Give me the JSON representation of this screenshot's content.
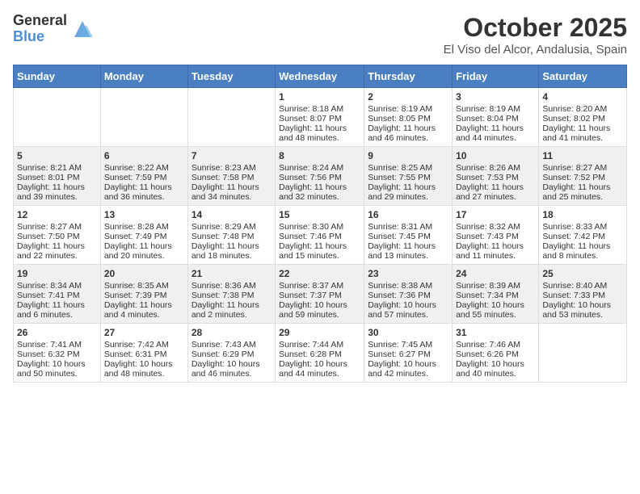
{
  "header": {
    "logo_general": "General",
    "logo_blue": "Blue",
    "month": "October 2025",
    "location": "El Viso del Alcor, Andalusia, Spain"
  },
  "days_of_week": [
    "Sunday",
    "Monday",
    "Tuesday",
    "Wednesday",
    "Thursday",
    "Friday",
    "Saturday"
  ],
  "weeks": [
    [
      {
        "day": "",
        "sunrise": "",
        "sunset": "",
        "daylight": ""
      },
      {
        "day": "",
        "sunrise": "",
        "sunset": "",
        "daylight": ""
      },
      {
        "day": "",
        "sunrise": "",
        "sunset": "",
        "daylight": ""
      },
      {
        "day": "1",
        "sunrise": "Sunrise: 8:18 AM",
        "sunset": "Sunset: 8:07 PM",
        "daylight": "Daylight: 11 hours and 48 minutes."
      },
      {
        "day": "2",
        "sunrise": "Sunrise: 8:19 AM",
        "sunset": "Sunset: 8:05 PM",
        "daylight": "Daylight: 11 hours and 46 minutes."
      },
      {
        "day": "3",
        "sunrise": "Sunrise: 8:19 AM",
        "sunset": "Sunset: 8:04 PM",
        "daylight": "Daylight: 11 hours and 44 minutes."
      },
      {
        "day": "4",
        "sunrise": "Sunrise: 8:20 AM",
        "sunset": "Sunset: 8:02 PM",
        "daylight": "Daylight: 11 hours and 41 minutes."
      }
    ],
    [
      {
        "day": "5",
        "sunrise": "Sunrise: 8:21 AM",
        "sunset": "Sunset: 8:01 PM",
        "daylight": "Daylight: 11 hours and 39 minutes."
      },
      {
        "day": "6",
        "sunrise": "Sunrise: 8:22 AM",
        "sunset": "Sunset: 7:59 PM",
        "daylight": "Daylight: 11 hours and 36 minutes."
      },
      {
        "day": "7",
        "sunrise": "Sunrise: 8:23 AM",
        "sunset": "Sunset: 7:58 PM",
        "daylight": "Daylight: 11 hours and 34 minutes."
      },
      {
        "day": "8",
        "sunrise": "Sunrise: 8:24 AM",
        "sunset": "Sunset: 7:56 PM",
        "daylight": "Daylight: 11 hours and 32 minutes."
      },
      {
        "day": "9",
        "sunrise": "Sunrise: 8:25 AM",
        "sunset": "Sunset: 7:55 PM",
        "daylight": "Daylight: 11 hours and 29 minutes."
      },
      {
        "day": "10",
        "sunrise": "Sunrise: 8:26 AM",
        "sunset": "Sunset: 7:53 PM",
        "daylight": "Daylight: 11 hours and 27 minutes."
      },
      {
        "day": "11",
        "sunrise": "Sunrise: 8:27 AM",
        "sunset": "Sunset: 7:52 PM",
        "daylight": "Daylight: 11 hours and 25 minutes."
      }
    ],
    [
      {
        "day": "12",
        "sunrise": "Sunrise: 8:27 AM",
        "sunset": "Sunset: 7:50 PM",
        "daylight": "Daylight: 11 hours and 22 minutes."
      },
      {
        "day": "13",
        "sunrise": "Sunrise: 8:28 AM",
        "sunset": "Sunset: 7:49 PM",
        "daylight": "Daylight: 11 hours and 20 minutes."
      },
      {
        "day": "14",
        "sunrise": "Sunrise: 8:29 AM",
        "sunset": "Sunset: 7:48 PM",
        "daylight": "Daylight: 11 hours and 18 minutes."
      },
      {
        "day": "15",
        "sunrise": "Sunrise: 8:30 AM",
        "sunset": "Sunset: 7:46 PM",
        "daylight": "Daylight: 11 hours and 15 minutes."
      },
      {
        "day": "16",
        "sunrise": "Sunrise: 8:31 AM",
        "sunset": "Sunset: 7:45 PM",
        "daylight": "Daylight: 11 hours and 13 minutes."
      },
      {
        "day": "17",
        "sunrise": "Sunrise: 8:32 AM",
        "sunset": "Sunset: 7:43 PM",
        "daylight": "Daylight: 11 hours and 11 minutes."
      },
      {
        "day": "18",
        "sunrise": "Sunrise: 8:33 AM",
        "sunset": "Sunset: 7:42 PM",
        "daylight": "Daylight: 11 hours and 8 minutes."
      }
    ],
    [
      {
        "day": "19",
        "sunrise": "Sunrise: 8:34 AM",
        "sunset": "Sunset: 7:41 PM",
        "daylight": "Daylight: 11 hours and 6 minutes."
      },
      {
        "day": "20",
        "sunrise": "Sunrise: 8:35 AM",
        "sunset": "Sunset: 7:39 PM",
        "daylight": "Daylight: 11 hours and 4 minutes."
      },
      {
        "day": "21",
        "sunrise": "Sunrise: 8:36 AM",
        "sunset": "Sunset: 7:38 PM",
        "daylight": "Daylight: 11 hours and 2 minutes."
      },
      {
        "day": "22",
        "sunrise": "Sunrise: 8:37 AM",
        "sunset": "Sunset: 7:37 PM",
        "daylight": "Daylight: 10 hours and 59 minutes."
      },
      {
        "day": "23",
        "sunrise": "Sunrise: 8:38 AM",
        "sunset": "Sunset: 7:36 PM",
        "daylight": "Daylight: 10 hours and 57 minutes."
      },
      {
        "day": "24",
        "sunrise": "Sunrise: 8:39 AM",
        "sunset": "Sunset: 7:34 PM",
        "daylight": "Daylight: 10 hours and 55 minutes."
      },
      {
        "day": "25",
        "sunrise": "Sunrise: 8:40 AM",
        "sunset": "Sunset: 7:33 PM",
        "daylight": "Daylight: 10 hours and 53 minutes."
      }
    ],
    [
      {
        "day": "26",
        "sunrise": "Sunrise: 7:41 AM",
        "sunset": "Sunset: 6:32 PM",
        "daylight": "Daylight: 10 hours and 50 minutes."
      },
      {
        "day": "27",
        "sunrise": "Sunrise: 7:42 AM",
        "sunset": "Sunset: 6:31 PM",
        "daylight": "Daylight: 10 hours and 48 minutes."
      },
      {
        "day": "28",
        "sunrise": "Sunrise: 7:43 AM",
        "sunset": "Sunset: 6:29 PM",
        "daylight": "Daylight: 10 hours and 46 minutes."
      },
      {
        "day": "29",
        "sunrise": "Sunrise: 7:44 AM",
        "sunset": "Sunset: 6:28 PM",
        "daylight": "Daylight: 10 hours and 44 minutes."
      },
      {
        "day": "30",
        "sunrise": "Sunrise: 7:45 AM",
        "sunset": "Sunset: 6:27 PM",
        "daylight": "Daylight: 10 hours and 42 minutes."
      },
      {
        "day": "31",
        "sunrise": "Sunrise: 7:46 AM",
        "sunset": "Sunset: 6:26 PM",
        "daylight": "Daylight: 10 hours and 40 minutes."
      },
      {
        "day": "",
        "sunrise": "",
        "sunset": "",
        "daylight": ""
      }
    ]
  ]
}
